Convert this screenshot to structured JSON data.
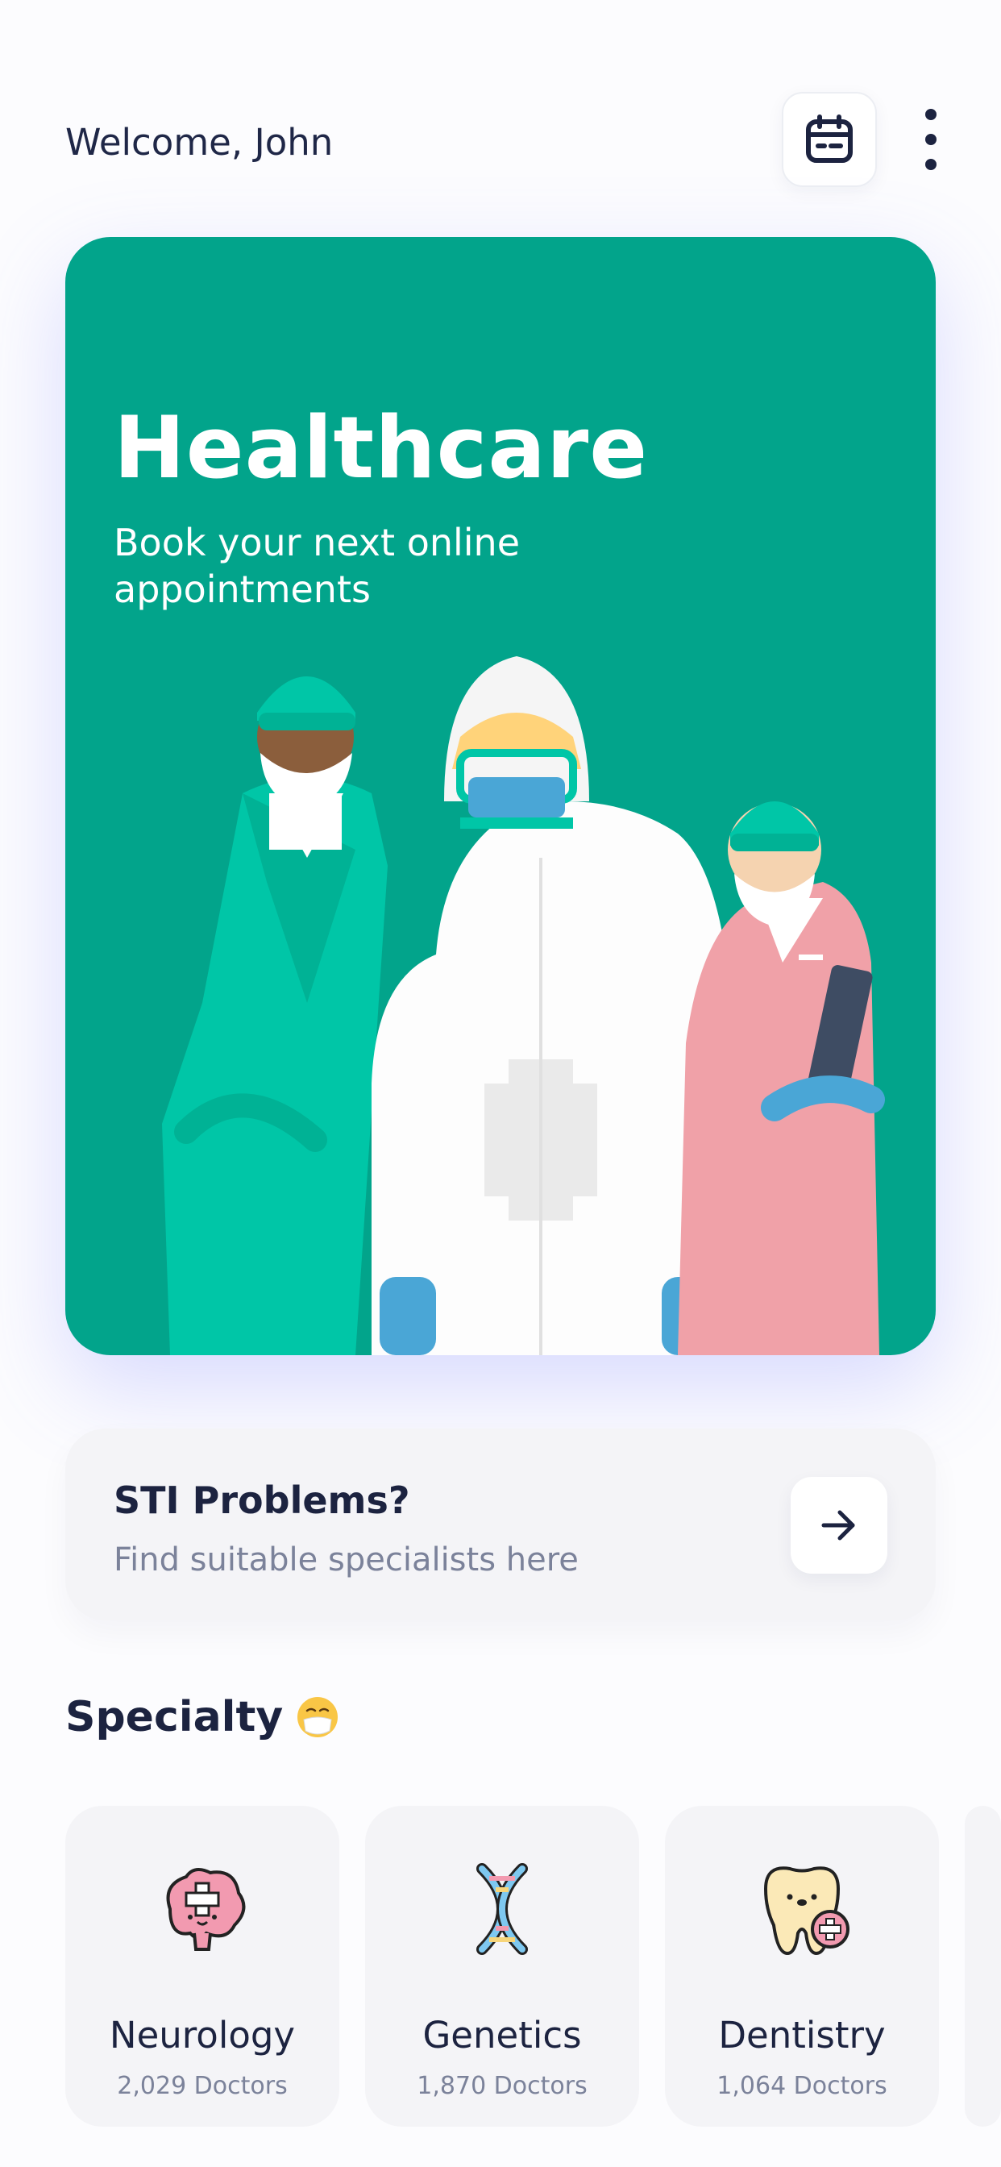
{
  "header": {
    "welcome_text": "Welcome, John",
    "calendar_icon": "calendar-icon",
    "menu_icon": "more-vertical-icon"
  },
  "hero": {
    "title": "Healthcare",
    "subtitle": "Book your next online appointments",
    "background_color": "#02a48b",
    "illustration": "medical-staff-illustration"
  },
  "sti_card": {
    "title": "STI Problems?",
    "subtitle": "Find suitable specialists here",
    "arrow_icon": "arrow-right-icon"
  },
  "specialty": {
    "title": "Specialty",
    "emoji_icon": "mask-face-emoji-icon",
    "items": [
      {
        "name": "Neurology",
        "count": "2,029 Doctors",
        "icon": "brain-icon"
      },
      {
        "name": "Genetics",
        "count": "1,870 Doctors",
        "icon": "dna-icon"
      },
      {
        "name": "Dentistry",
        "count": "1,064 Doctors",
        "icon": "tooth-icon"
      }
    ]
  }
}
